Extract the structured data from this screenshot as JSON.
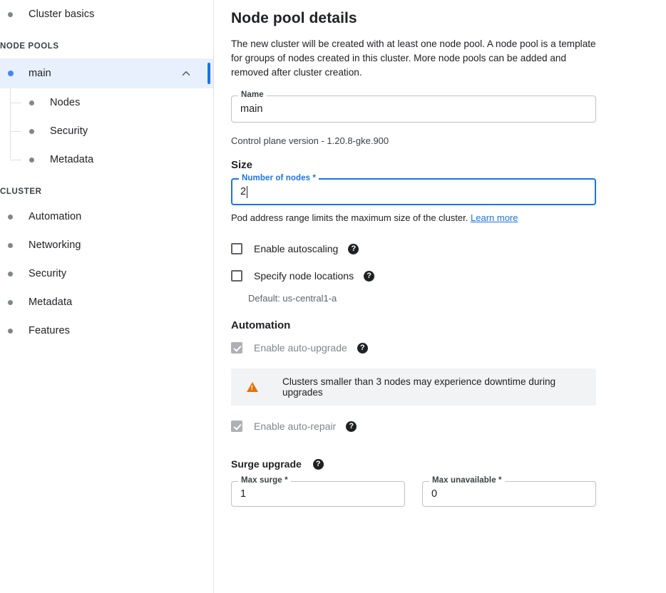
{
  "sidebar": {
    "top_items": [
      {
        "label": "Cluster basics",
        "icon": "bullet-icon"
      }
    ],
    "node_pools_label": "NODE POOLS",
    "pool": {
      "label": "main",
      "expand_icon": "chevron-up-icon",
      "children": [
        {
          "label": "Nodes"
        },
        {
          "label": "Security"
        },
        {
          "label": "Metadata"
        }
      ]
    },
    "cluster_label": "CLUSTER",
    "cluster_items": [
      {
        "label": "Automation"
      },
      {
        "label": "Networking"
      },
      {
        "label": "Security"
      },
      {
        "label": "Metadata"
      },
      {
        "label": "Features"
      }
    ]
  },
  "main": {
    "title": "Node pool details",
    "description": "The new cluster will be created with at least one node pool. A node pool is a template for groups of nodes created in this cluster. More node pools can be added and removed after cluster creation.",
    "name_field": {
      "label": "Name",
      "value": "main"
    },
    "control_plane_version": "Control plane version - 1.20.8-gke.900",
    "size_heading": "Size",
    "nodes_field": {
      "label": "Number of nodes *",
      "value": "2"
    },
    "pod_hint": {
      "text": "Pod address range limits the maximum size of the cluster.",
      "link": "Learn more"
    },
    "autoscaling": {
      "label": "Enable autoscaling",
      "help_icon": "help-icon",
      "checked": false
    },
    "node_locations": {
      "label": "Specify node locations",
      "help_icon": "help-icon",
      "checked": false,
      "default_text": "Default: us-central1-a"
    },
    "automation_heading": "Automation",
    "auto_upgrade": {
      "label": "Enable auto-upgrade",
      "help_icon": "help-icon",
      "checked": true,
      "disabled": true
    },
    "warning": {
      "icon": "warning-triangle-icon",
      "text": "Clusters smaller than 3 nodes may experience downtime during upgrades"
    },
    "auto_repair": {
      "label": "Enable auto-repair",
      "help_icon": "help-icon",
      "checked": true,
      "disabled": true
    },
    "surge": {
      "heading": "Surge upgrade",
      "help_icon": "help-icon",
      "max_surge": {
        "label": "Max surge *",
        "value": "1"
      },
      "max_unavailable": {
        "label": "Max unavailable *",
        "value": "0"
      }
    }
  },
  "colors": {
    "accent_blue": "#1a73e8",
    "bullet_blue": "#4285f4",
    "selected_bg": "#e8f0fe",
    "warning_orange": "#e8710a",
    "banner_bg": "#f1f3f4",
    "muted_text": "#5f6368"
  },
  "glyphs": {
    "help": "?"
  }
}
